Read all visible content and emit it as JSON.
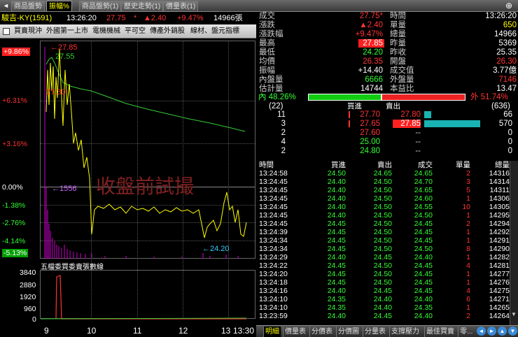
{
  "tabs": [
    {
      "label": "商品盤勢"
    },
    {
      "label": "振幅%"
    },
    {
      "label": "商品盤勢(1)"
    },
    {
      "label": "歷史走勢(1)"
    },
    {
      "label": "價量表(1)"
    }
  ],
  "header": {
    "name": "駿吉-KY(1591)",
    "time": "13:26:20",
    "price": "27.75",
    "star": "*",
    "change": "▲2.40",
    "pct": "+9.47%",
    "volume": "14966張"
  },
  "toolbar": {
    "items": [
      "買賣現沖",
      "外國第一上市",
      "電機機械",
      "平可空",
      "傳產外銷股",
      "線材、盤元指標"
    ]
  },
  "chart": {
    "y_labels": [
      "+9.86%",
      "+6.31%",
      "+3.16%",
      "0.00%",
      "-1.38%",
      "-2.76%",
      "-4.14%",
      "-5.13%"
    ],
    "annotations": {
      "high": "27.85",
      "peak_avg": "27.55",
      "mid": "27.30",
      "vol": "1556",
      "low": "24.20"
    },
    "watermark": "收盤前試撮",
    "lower_title": "五檔委買委賣張數線",
    "lower_y": [
      "3840",
      "2880",
      "1920",
      "960",
      "0"
    ],
    "x_labels": [
      "9",
      "10",
      "11",
      "12",
      "13",
      "13:30"
    ]
  },
  "quote": {
    "left": [
      {
        "label": "成交",
        "value": "27.75*",
        "color": "red"
      },
      {
        "label": "漲跌",
        "value": "▲2.40",
        "color": "red"
      },
      {
        "label": "漲跌幅",
        "value": "+9.47%",
        "color": "red"
      },
      {
        "label": "最高",
        "value": "27.85",
        "color": "hl"
      },
      {
        "label": "最低",
        "value": "24.20",
        "color": "grn"
      },
      {
        "label": "均價",
        "value": "26.35",
        "color": "red"
      },
      {
        "label": "振幅",
        "value": "+14.40",
        "color": "wht"
      },
      {
        "label": "內盤量",
        "value": "6666",
        "color": "grn"
      },
      {
        "label": "估計量",
        "value": "14744",
        "color": "wht"
      }
    ],
    "right": [
      {
        "label": "時間",
        "value": "13:26:20",
        "color": "wht"
      },
      {
        "label": "單量",
        "value": "650",
        "color": "yel"
      },
      {
        "label": "總量",
        "value": "14966",
        "color": "wht"
      },
      {
        "label": "昨量",
        "value": "5369",
        "color": "wht"
      },
      {
        "label": "昨收",
        "value": "25.35",
        "color": "wht"
      },
      {
        "label": "開盤",
        "value": "26.30",
        "color": "red"
      },
      {
        "label": "成交值",
        "value": "3.77億",
        "color": "wht"
      },
      {
        "label": "外盤量",
        "value": "7146",
        "color": "red"
      },
      {
        "label": "本益比",
        "value": "13.47",
        "color": "wht"
      }
    ],
    "inner_label": "內",
    "inner_pct": "48.26%",
    "outer_label": "外",
    "outer_pct": "51.74%"
  },
  "book": {
    "left_total": "(22)",
    "right_total": "(636)",
    "bid_header": "買進",
    "ask_header": "賣出",
    "rows": [
      {
        "bq": "11",
        "bp": "27.70",
        "ap": "27.80",
        "aq": "66"
      },
      {
        "bq": "3",
        "bp": "27.65",
        "ap": "27.85",
        "aq": "570"
      },
      {
        "bq": "2",
        "bp": "27.60",
        "ap": "--",
        "aq": "0"
      },
      {
        "bq": "4",
        "bp": "25.00",
        "ap": "--",
        "aq": "0"
      },
      {
        "bq": "2",
        "bp": "24.80",
        "ap": "--",
        "aq": "0"
      }
    ]
  },
  "ticks": {
    "headers": [
      "時間",
      "買進",
      "賣出",
      "成交",
      "單量",
      "總量"
    ],
    "rows": [
      [
        "13:24:58",
        "24.50",
        "24.65",
        "24.65",
        "2",
        "14316"
      ],
      [
        "13:24:45",
        "24.40",
        "24.50",
        "24.70",
        "3",
        "14314"
      ],
      [
        "13:24:45",
        "24.40",
        "24.50",
        "24.65",
        "5",
        "14311"
      ],
      [
        "13:24:45",
        "24.40",
        "24.50",
        "24.60",
        "1",
        "14306"
      ],
      [
        "13:24:45",
        "24.40",
        "24.50",
        "24.55",
        "10",
        "14305"
      ],
      [
        "13:24:45",
        "24.40",
        "24.50",
        "24.50",
        "1",
        "14295"
      ],
      [
        "13:24:45",
        "24.45",
        "24.50",
        "24.45",
        "2",
        "14294"
      ],
      [
        "13:24:39",
        "24.45",
        "24.50",
        "24.45",
        "1",
        "14292"
      ],
      [
        "13:24:34",
        "24.45",
        "24.50",
        "24.45",
        "1",
        "14291"
      ],
      [
        "13:24:34",
        "24.45",
        "24.50",
        "24.50",
        "8",
        "14290"
      ],
      [
        "13:24:29",
        "24.40",
        "24.45",
        "24.40",
        "1",
        "14282"
      ],
      [
        "13:24:22",
        "24.45",
        "24.50",
        "24.45",
        "4",
        "14281"
      ],
      [
        "13:24:20",
        "24.45",
        "24.50",
        "24.45",
        "1",
        "14277"
      ],
      [
        "13:24:18",
        "24.45",
        "24.50",
        "24.45",
        "1",
        "14276"
      ],
      [
        "13:24:16",
        "24.40",
        "24.45",
        "24.45",
        "4",
        "14275"
      ],
      [
        "13:24:10",
        "24.35",
        "24.40",
        "24.40",
        "6",
        "14271"
      ],
      [
        "13:24:10",
        "24.35",
        "24.40",
        "24.35",
        "1",
        "14265"
      ],
      [
        "13:23:59",
        "24.40",
        "24.45",
        "24.40",
        "2",
        "14264"
      ]
    ]
  },
  "bottom_tabs": [
    "明細",
    "價量表",
    "分價表",
    "分價圖",
    "分量表",
    "支撐壓力",
    "最佳買賣",
    "零..."
  ]
}
